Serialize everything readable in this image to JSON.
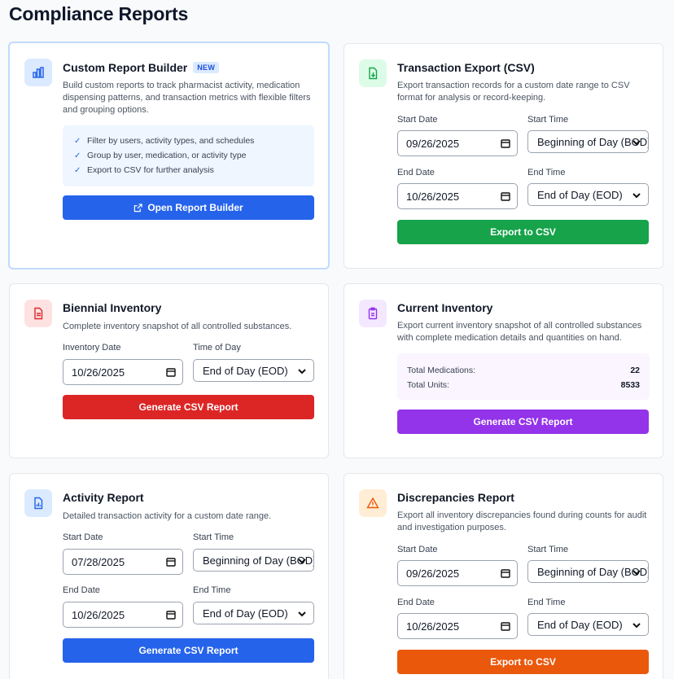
{
  "page": {
    "title": "Compliance Reports"
  },
  "colors": {
    "blue": "#2563eb",
    "green": "#16a34a",
    "red": "#dc2626",
    "purple": "#9333ea",
    "orange": "#ea580c"
  },
  "custom_builder": {
    "title": "Custom Report Builder",
    "badge": "NEW",
    "description": "Build custom reports to track pharmacist activity, medication dispensing patterns, and transaction metrics with flexible filters and grouping options.",
    "features": [
      "Filter by users, activity types, and schedules",
      "Group by user, medication, or activity type",
      "Export to CSV for further analysis"
    ],
    "button": "Open Report Builder",
    "icon": "bar-chart-icon"
  },
  "transaction_export": {
    "title": "Transaction Export (CSV)",
    "description": "Export transaction records for a custom date range to CSV format for analysis or record-keeping.",
    "start_date_label": "Start Date",
    "start_date": "09/26/2025",
    "start_time_label": "Start Time",
    "start_time": "Beginning of Day (BOD)",
    "end_date_label": "End Date",
    "end_date": "10/26/2025",
    "end_time_label": "End Time",
    "end_time": "End of Day (EOD)",
    "button": "Export to CSV",
    "icon": "file-download-icon"
  },
  "biennial_inventory": {
    "title": "Biennial Inventory",
    "description": "Complete inventory snapshot of all controlled substances.",
    "date_label": "Inventory Date",
    "date": "10/26/2025",
    "time_label": "Time of Day",
    "time": "End of Day (EOD)",
    "button": "Generate CSV Report",
    "icon": "file-text-icon"
  },
  "current_inventory": {
    "title": "Current Inventory",
    "description": "Export current inventory snapshot of all controlled substances with complete medication details and quantities on hand.",
    "stats": [
      {
        "label": "Total Medications:",
        "value": "22"
      },
      {
        "label": "Total Units:",
        "value": "8533"
      }
    ],
    "button": "Generate CSV Report",
    "icon": "clipboard-icon"
  },
  "activity_report": {
    "title": "Activity Report",
    "description": "Detailed transaction activity for a custom date range.",
    "start_date_label": "Start Date",
    "start_date": "07/28/2025",
    "start_time_label": "Start Time",
    "start_time": "Beginning of Day (BOD)",
    "end_date_label": "End Date",
    "end_date": "10/26/2025",
    "end_time_label": "End Time",
    "end_time": "End of Day (EOD)",
    "button": "Generate CSV Report",
    "icon": "file-chart-icon"
  },
  "discrepancies_report": {
    "title": "Discrepancies Report",
    "description": "Export all inventory discrepancies found during counts for audit and investigation purposes.",
    "start_date_label": "Start Date",
    "start_date": "09/26/2025",
    "start_time_label": "Start Time",
    "start_time": "Beginning of Day (BOD)",
    "end_date_label": "End Date",
    "end_date": "10/26/2025",
    "end_time_label": "End Time",
    "end_time": "End of Day (EOD)",
    "button": "Export to CSV",
    "icon": "warning-icon"
  }
}
